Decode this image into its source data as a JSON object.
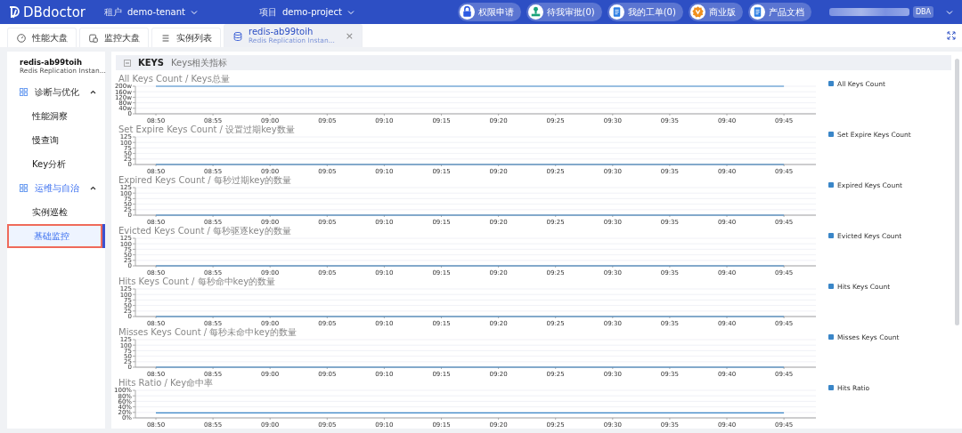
{
  "header": {
    "logo": "DBdoctor",
    "tenant": {
      "label": "租户",
      "value": "demo-tenant"
    },
    "project": {
      "label": "项目",
      "value": "demo-project"
    },
    "actions": [
      {
        "kind": "lock",
        "label": "权限申请"
      },
      {
        "kind": "stamp",
        "label": "待我审批(0)"
      },
      {
        "kind": "doc",
        "label": "我的工单(0)"
      },
      {
        "kind": "badge",
        "label": "商业版"
      },
      {
        "kind": "doc",
        "label": "产品文档"
      }
    ],
    "role": "DBA"
  },
  "tabs": [
    {
      "kind": "gauge",
      "label": "性能大盘",
      "selected": false
    },
    {
      "kind": "monitor",
      "label": "监控大盘",
      "selected": false
    },
    {
      "kind": "list",
      "label": "实例列表",
      "selected": false
    },
    {
      "kind": "database",
      "label": "redis-ab99toih",
      "sublabel": "Redis Replication Instan...",
      "selected": true,
      "close_icon": "×"
    }
  ],
  "sidebar": {
    "title": "redis-ab99toih",
    "subtitle": "Redis Replication Instan...",
    "groups": [
      {
        "label": "诊断与优化",
        "selected": false,
        "expanded": true,
        "children": [
          {
            "label": "性能洞察",
            "selected": false
          },
          {
            "label": "慢查询",
            "selected": false
          },
          {
            "label": "Key分析",
            "selected": false
          }
        ]
      },
      {
        "label": "运维与自治",
        "selected": true,
        "expanded": true,
        "children": [
          {
            "label": "实例巡检",
            "selected": false
          },
          {
            "label": "基础监控",
            "selected": true
          }
        ]
      }
    ]
  },
  "section": {
    "title": "KEYS",
    "subtitle": "Keys相关指标",
    "expanded": true
  },
  "charts": [
    {
      "chart_data": {
        "type": "line",
        "grid": true,
        "title": "All Keys Count / Keys总量",
        "x": [
          "08:50",
          "08:55",
          "09:00",
          "09:05",
          "09:10",
          "09:15",
          "09:20",
          "09:25",
          "09:30",
          "09:35",
          "09:40",
          "09:45"
        ],
        "ylim": [
          0,
          200
        ],
        "yticks": [
          {
            "value": 0,
            "label": "0"
          },
          {
            "value": 40,
            "label": "40w"
          },
          {
            "value": 80,
            "label": "80w"
          },
          {
            "value": 120,
            "label": "120w"
          },
          {
            "value": 160,
            "label": "160w"
          },
          {
            "value": 200,
            "label": "200w"
          }
        ],
        "series": [
          {
            "name": "All Keys Count",
            "color": "#3a86c8",
            "values": [
              200,
              200,
              200,
              200,
              200,
              200,
              200,
              200,
              200,
              200,
              200,
              200
            ]
          }
        ]
      }
    },
    {
      "chart_data": {
        "type": "line",
        "grid": true,
        "title": "Set Expire Keys Count / 设置过期key数量",
        "x": [
          "08:50",
          "08:55",
          "09:00",
          "09:05",
          "09:10",
          "09:15",
          "09:20",
          "09:25",
          "09:30",
          "09:35",
          "09:40",
          "09:45"
        ],
        "ylim": [
          0,
          125
        ],
        "yticks": [
          0,
          25,
          50,
          75,
          100,
          125
        ],
        "series": [
          {
            "name": "Set Expire Keys Count",
            "color": "#3a86c8",
            "values": [
              0,
              0,
              0,
              0,
              0,
              0,
              0,
              0,
              0,
              0,
              0,
              0
            ]
          }
        ]
      }
    },
    {
      "chart_data": {
        "type": "line",
        "grid": true,
        "title": "Expired Keys Count / 每秒过期key的数量",
        "x": [
          "08:50",
          "08:55",
          "09:00",
          "09:05",
          "09:10",
          "09:15",
          "09:20",
          "09:25",
          "09:30",
          "09:35",
          "09:40",
          "09:45"
        ],
        "ylim": [
          0,
          125
        ],
        "yticks": [
          0,
          25,
          50,
          75,
          100,
          125
        ],
        "series": [
          {
            "name": "Expired Keys Count",
            "color": "#3a86c8",
            "values": [
              0,
              0,
              0,
              0,
              0,
              0,
              0,
              0,
              0,
              0,
              0,
              0
            ]
          }
        ]
      }
    },
    {
      "chart_data": {
        "type": "line",
        "grid": true,
        "title": "Evicted Keys Count / 每秒驱逐key的数量",
        "x": [
          "08:50",
          "08:55",
          "09:00",
          "09:05",
          "09:10",
          "09:15",
          "09:20",
          "09:25",
          "09:30",
          "09:35",
          "09:40",
          "09:45"
        ],
        "ylim": [
          0,
          125
        ],
        "yticks": [
          0,
          25,
          50,
          75,
          100,
          125
        ],
        "series": [
          {
            "name": "Evicted Keys Count",
            "color": "#3a86c8",
            "values": [
              0,
              0,
              0,
              0,
              0,
              0,
              0,
              0,
              0,
              0,
              0,
              0
            ]
          }
        ]
      }
    },
    {
      "chart_data": {
        "type": "line",
        "grid": true,
        "title": "Hits Keys Count / 每秒命中key的数量",
        "x": [
          "08:50",
          "08:55",
          "09:00",
          "09:05",
          "09:10",
          "09:15",
          "09:20",
          "09:25",
          "09:30",
          "09:35",
          "09:40",
          "09:45"
        ],
        "ylim": [
          0,
          125
        ],
        "yticks": [
          0,
          25,
          50,
          75,
          100,
          125
        ],
        "series": [
          {
            "name": "Hits Keys Count",
            "color": "#3a86c8",
            "values": [
              0,
              0,
              0,
              0,
              0,
              0,
              0,
              0,
              0,
              0,
              0,
              0
            ]
          }
        ]
      }
    },
    {
      "chart_data": {
        "type": "line",
        "grid": true,
        "title": "Misses Keys Count / 每秒未命中key的数量",
        "x": [
          "08:50",
          "08:55",
          "09:00",
          "09:05",
          "09:10",
          "09:15",
          "09:20",
          "09:25",
          "09:30",
          "09:35",
          "09:40",
          "09:45"
        ],
        "ylim": [
          0,
          125
        ],
        "yticks": [
          0,
          25,
          50,
          75,
          100,
          125
        ],
        "series": [
          {
            "name": "Misses Keys Count",
            "color": "#3a86c8",
            "values": [
              0,
              0,
              0,
              0,
              0,
              0,
              0,
              0,
              0,
              0,
              0,
              0
            ]
          }
        ]
      }
    },
    {
      "chart_data": {
        "type": "line",
        "grid": true,
        "title": "Hits Ratio / Key命中率",
        "x": [
          "08:50",
          "08:55",
          "09:00",
          "09:05",
          "09:10",
          "09:15",
          "09:20",
          "09:25",
          "09:30",
          "09:35",
          "09:40",
          "09:45"
        ],
        "ylim": [
          0,
          100
        ],
        "yticks": [
          {
            "value": 0,
            "label": "0%"
          },
          {
            "value": 20,
            "label": "20%"
          },
          {
            "value": 40,
            "label": "40%"
          },
          {
            "value": 60,
            "label": "60%"
          },
          {
            "value": 80,
            "label": "80%"
          },
          {
            "value": 100,
            "label": "100%"
          }
        ],
        "series": [
          {
            "name": "Hits Ratio",
            "color": "#3a86c8",
            "values": [
              18,
              18,
              18,
              18,
              18,
              18,
              18,
              18,
              18,
              18,
              18,
              18
            ]
          }
        ]
      }
    }
  ]
}
